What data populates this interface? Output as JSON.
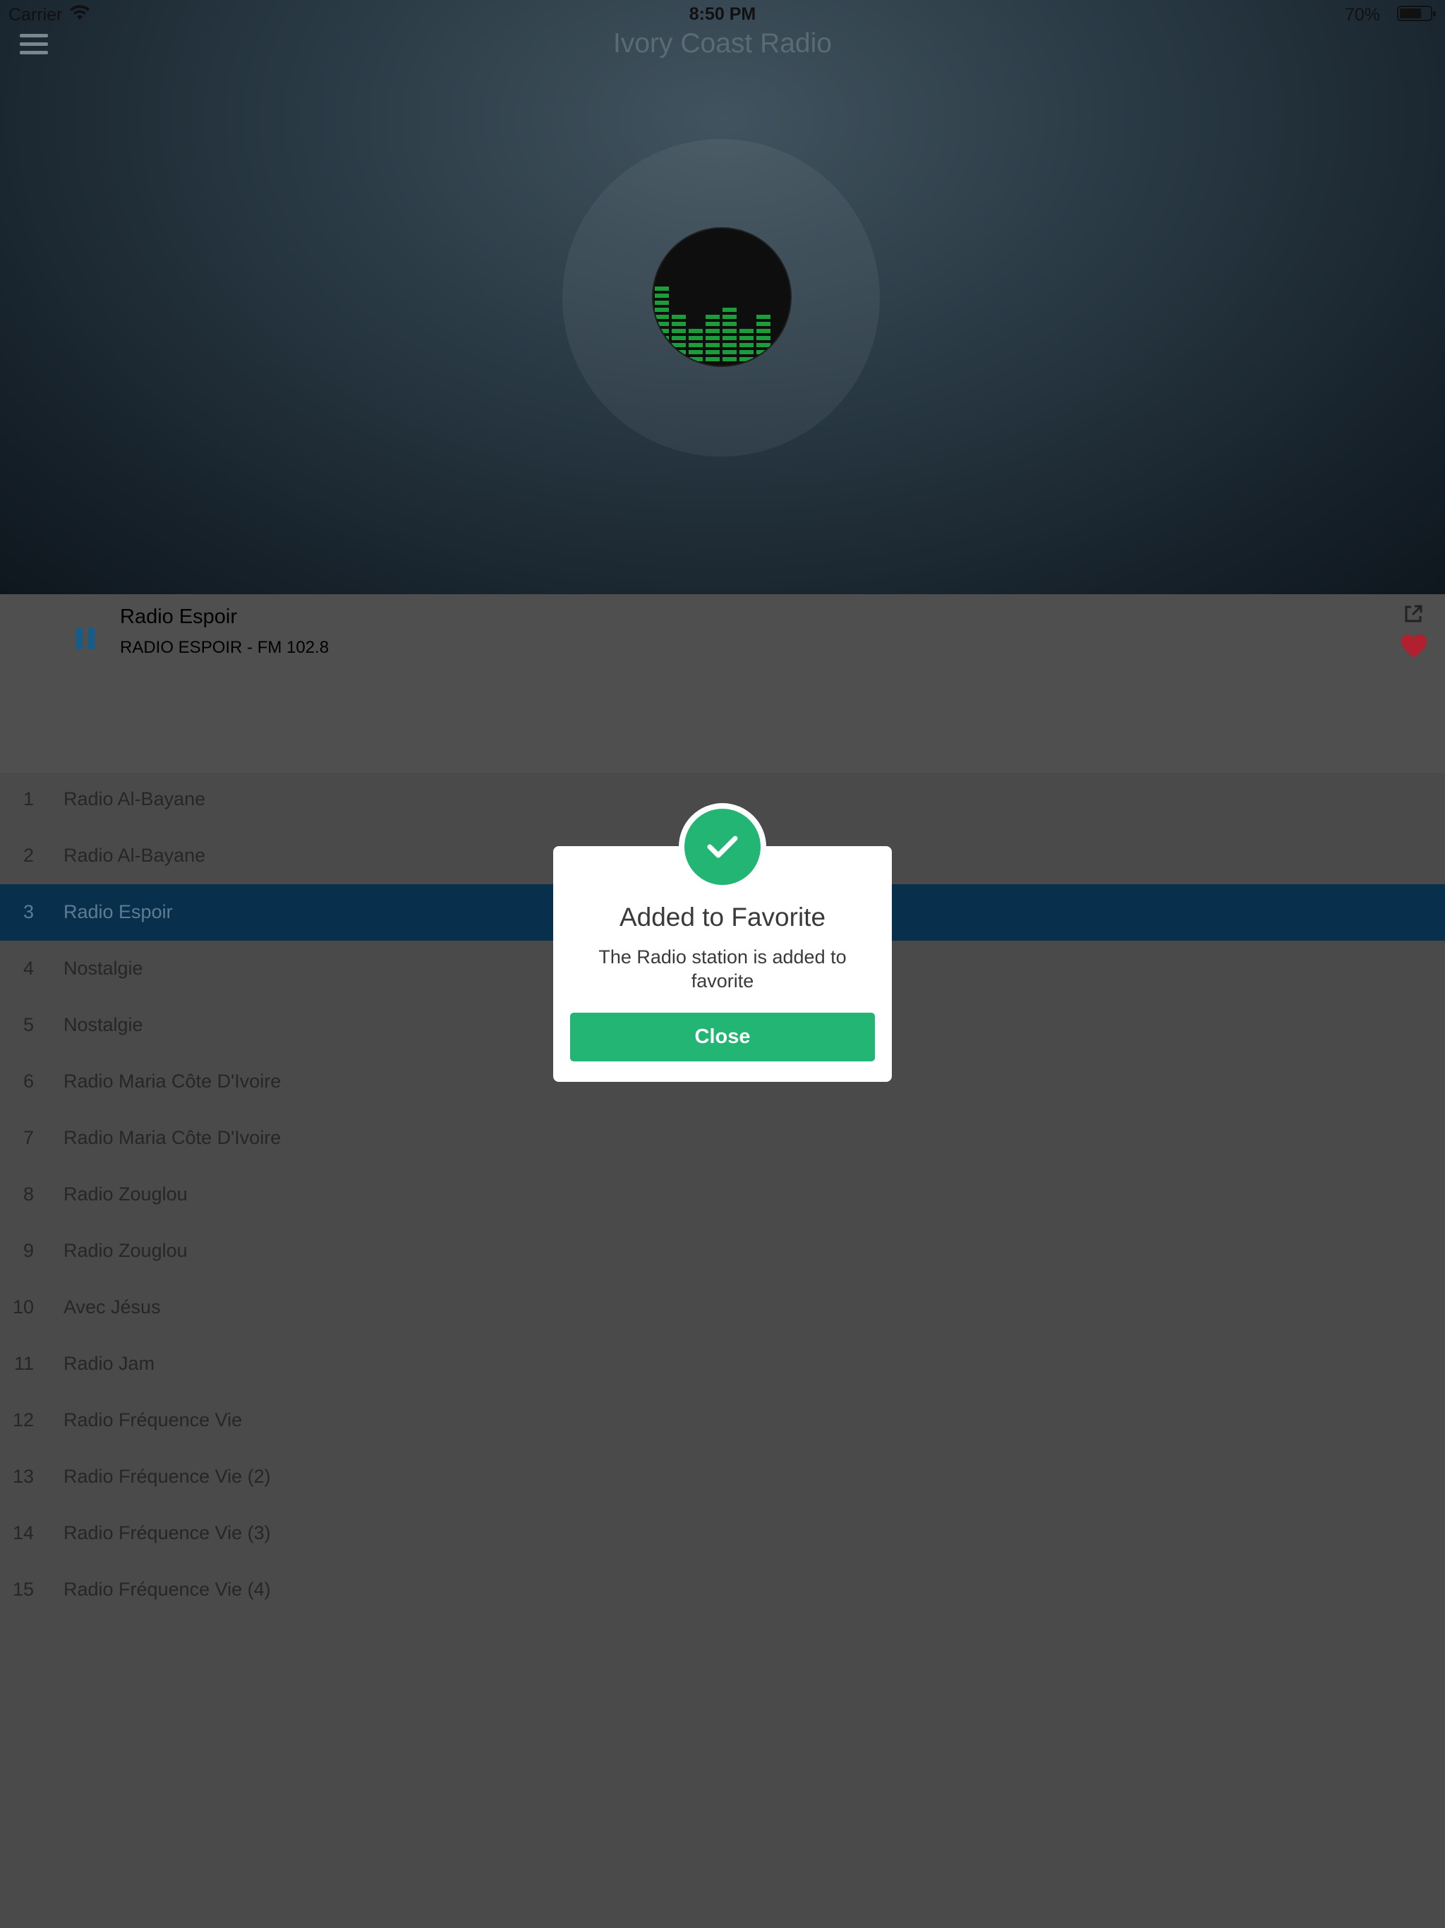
{
  "status_bar": {
    "carrier": "Carrier",
    "time": "8:50 PM",
    "battery_percent": "70%"
  },
  "header": {
    "title": "Ivory Coast Radio",
    "menu_icon": "hamburger-menu-icon"
  },
  "now_playing": {
    "title": "Radio Espoir",
    "subtitle": "RADIO ESPOIR - FM 102.8",
    "state": "playing",
    "favorite": true
  },
  "stations": [
    {
      "num": "1",
      "name": "Radio Al-Bayane"
    },
    {
      "num": "2",
      "name": "Radio Al-Bayane"
    },
    {
      "num": "3",
      "name": "Radio Espoir",
      "active": true
    },
    {
      "num": "4",
      "name": "Nostalgie"
    },
    {
      "num": "5",
      "name": "Nostalgie"
    },
    {
      "num": "6",
      "name": "Radio Maria Côte D'Ivoire"
    },
    {
      "num": "7",
      "name": "Radio Maria Côte D'Ivoire"
    },
    {
      "num": "8",
      "name": "Radio Zouglou"
    },
    {
      "num": "9",
      "name": "Radio Zouglou"
    },
    {
      "num": "10",
      "name": "Avec Jésus"
    },
    {
      "num": "11",
      "name": "Radio Jam"
    },
    {
      "num": "12",
      "name": "Radio Fréquence Vie"
    },
    {
      "num": "13",
      "name": "Radio Fréquence Vie (2)"
    },
    {
      "num": "14",
      "name": "Radio Fréquence Vie (3)"
    },
    {
      "num": "15",
      "name": "Radio Fréquence Vie (4)"
    }
  ],
  "dialog": {
    "title": "Added to Favorite",
    "message": "The Radio station is added to favorite",
    "close_label": "Close"
  },
  "colors": {
    "accent_green": "#23b574",
    "active_row": "#08304c",
    "favorite_red": "#b0202e",
    "pause_blue": "#145c8c"
  }
}
